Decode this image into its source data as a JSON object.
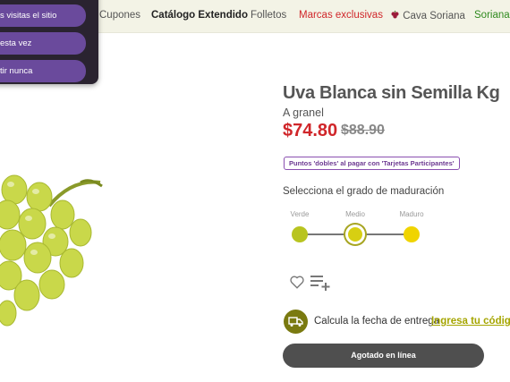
{
  "popup": {
    "buttons": [
      "s visitas el sitio",
      "esta vez",
      "tir nunca"
    ]
  },
  "nav": {
    "items": [
      {
        "label": "Cupones"
      },
      {
        "label": "Catálogo Extendido"
      },
      {
        "label": "Folletos"
      },
      {
        "label": "Marcas exclusivas"
      },
      {
        "label": "Cava Soriana"
      },
      {
        "label": "Soriana"
      }
    ]
  },
  "product": {
    "name": "Uva Blanca sin Semilla Kg",
    "unit": "A granel",
    "price": "$74.80",
    "old_price": "$88.90",
    "points_badge": "Puntos 'dobles' al pagar con 'Tarjetas Participantes'",
    "ripeness": {
      "title": "Selecciona el grado de maduración",
      "options": [
        "Verde",
        "Medio",
        "Maduro"
      ],
      "selected": "Medio"
    },
    "delivery_text": "Calcula la fecha de entrega",
    "delivery_link": "Ingresa tu código p",
    "out_of_stock_label": "Agotado en línea"
  },
  "colors": {
    "price_red": "#d0262a",
    "popup_purple": "#6a4a9c",
    "ripe_green": "#b8c420",
    "ripe_yellow": "#f0d400",
    "olive": "#7a7a10"
  },
  "icons": [
    "heart-icon",
    "add-to-list-icon",
    "delivery-truck-icon",
    "wine-glass-icon"
  ]
}
